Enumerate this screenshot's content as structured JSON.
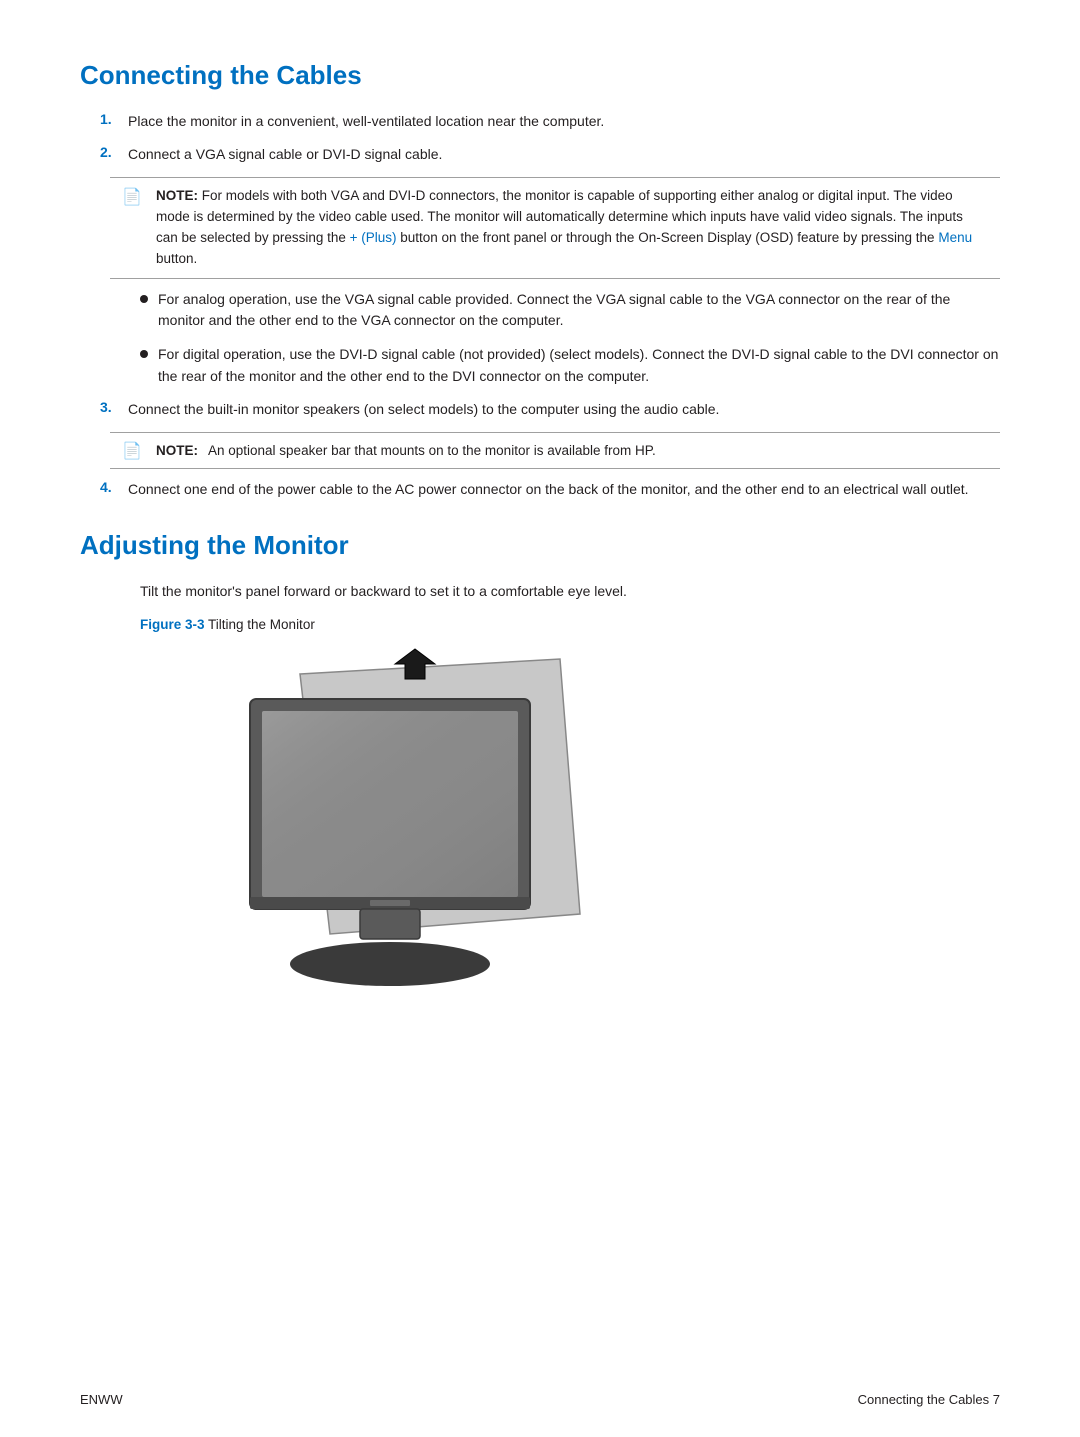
{
  "sections": {
    "section1": {
      "title": "Connecting the Cables",
      "steps": [
        {
          "num": "1.",
          "text": "Place the monitor in a convenient, well-ventilated location near the computer."
        },
        {
          "num": "2.",
          "text": "Connect a VGA signal cable or DVI-D signal cable."
        },
        {
          "num": "3.",
          "text": "Connect the built-in monitor speakers (on select models) to the computer using the audio cable."
        },
        {
          "num": "4.",
          "text": "Connect one end of the power cable to the AC power connector on the back of the monitor, and the other end to an electrical wall outlet."
        }
      ],
      "note1": {
        "label": "NOTE:",
        "text_before": "For models with both VGA and DVI-D connectors, the monitor is capable of supporting either analog or digital input. The video mode is determined by the video cable used. The monitor will automatically determine which inputs have valid video signals. The inputs can be selected by pressing the ",
        "link1": "+ (Plus)",
        "text_middle": " button on the front panel or through the On-Screen Display (OSD) feature by pressing the ",
        "link2": "Menu",
        "text_after": " button."
      },
      "bullets": [
        {
          "text": "For analog operation, use the VGA signal cable provided. Connect the VGA signal cable to the VGA connector on the rear of the monitor and the other end to the VGA connector on the computer."
        },
        {
          "text": "For digital operation, use the DVI-D signal cable (not provided) (select models). Connect the DVI-D signal cable to the DVI connector on the rear of the monitor and the other end to the DVI connector on the computer."
        }
      ],
      "note2": {
        "label": "NOTE:",
        "text": "An optional speaker bar that mounts on to the monitor is available from HP."
      }
    },
    "section2": {
      "title": "Adjusting the Monitor",
      "intro": "Tilt the monitor's panel forward or backward to set it to a comfortable eye level.",
      "figure_label_bold": "Figure 3-3",
      "figure_label_text": "  Tilting the Monitor"
    }
  },
  "footer": {
    "left": "ENWW",
    "right": "Connecting the Cables    7"
  }
}
